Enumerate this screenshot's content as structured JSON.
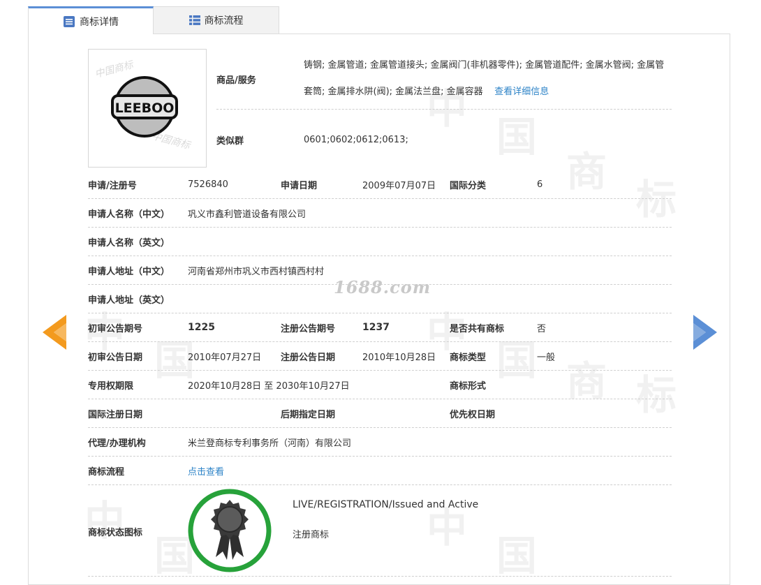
{
  "tabs": [
    {
      "label": "商标详情",
      "active": true
    },
    {
      "label": "商标流程",
      "active": false
    }
  ],
  "logo": {
    "text": "LEEBOO",
    "watermark": "中国商标"
  },
  "goods": {
    "label": "商品/服务",
    "value": "铸钢; 金属管道; 金属管道接头; 金属阀门(非机器零件); 金属管道配件; 金属水管阀; 金属管套筒; 金属排水阱(阀); 金属法兰盘; 金属容器",
    "link": "查看详细信息"
  },
  "similar_group": {
    "label": "类似群",
    "value": "0601;0602;0612;0613;"
  },
  "fields": {
    "reg_no_label": "申请/注册号",
    "reg_no": "7526840",
    "app_date_label": "申请日期",
    "app_date": "2009年07月07日",
    "intl_class_label": "国际分类",
    "intl_class": "6",
    "applicant_cn_label": "申请人名称（中文）",
    "applicant_cn": "巩义市鑫利管道设备有限公司",
    "applicant_en_label": "申请人名称（英文）",
    "applicant_en": "",
    "address_cn_label": "申请人地址（中文）",
    "address_cn": "河南省郑州市巩义市西村镇西村村",
    "address_en_label": "申请人地址（英文）",
    "address_en": "",
    "prelim_no_label": "初审公告期号",
    "prelim_no": "1225",
    "reg_pub_no_label": "注册公告期号",
    "reg_pub_no": "1237",
    "shared_label": "是否共有商标",
    "shared": "否",
    "prelim_date_label": "初审公告日期",
    "prelim_date": "2010年07月27日",
    "reg_pub_date_label": "注册公告日期",
    "reg_pub_date": "2010年10月28日",
    "tm_type_label": "商标类型",
    "tm_type": "一般",
    "exclusive_label": "专用权期限",
    "exclusive": "2020年10月28日 至 2030年10月27日",
    "tm_form_label": "商标形式",
    "tm_form": "",
    "intl_reg_date_label": "国际注册日期",
    "intl_reg_date": "",
    "later_date_label": "后期指定日期",
    "later_date": "",
    "priority_label": "优先权日期",
    "priority": "",
    "agent_label": "代理/办理机构",
    "agent": "米兰登商标专利事务所（河南）有限公司",
    "process_label": "商标流程",
    "process_link": "点击查看",
    "status_label": "商标状态图标",
    "status_en": "LIVE/REGISTRATION/Issued and Active",
    "status_cn": "注册商标"
  },
  "site_watermark": "1688.com",
  "colors": {
    "accent": "#5b8fd6",
    "link": "#2d83c7",
    "left_arrow": "#f39a1e",
    "right_arrow": "#5b8fd6",
    "status_ring": "#27a23a"
  }
}
